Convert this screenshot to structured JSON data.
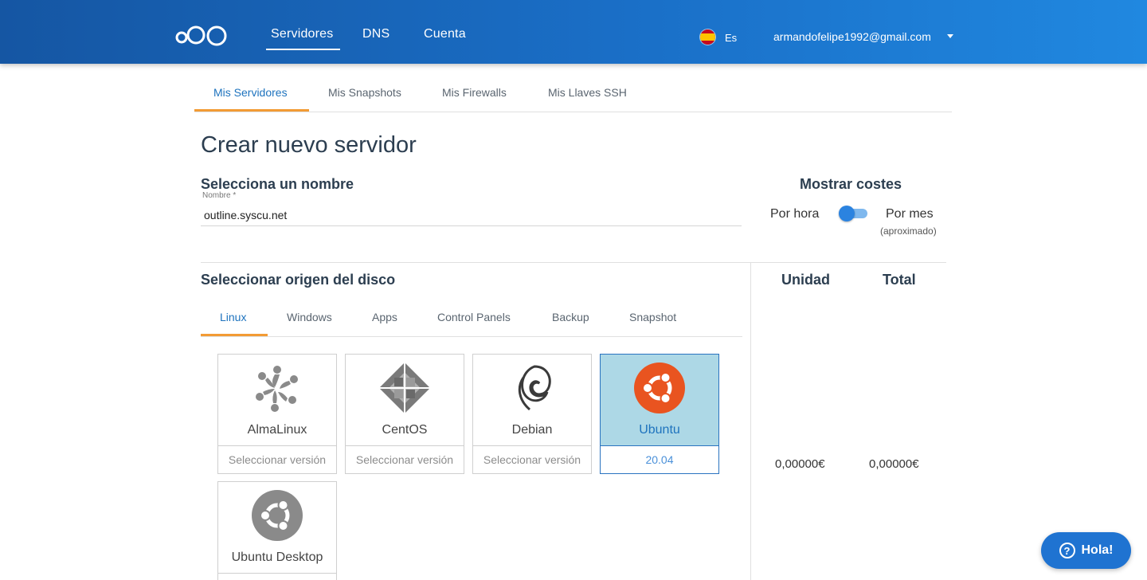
{
  "header": {
    "nav": [
      "Servidores",
      "DNS",
      "Cuenta"
    ],
    "lang": "Es",
    "user_email": "armandofelipe1992@gmail.com"
  },
  "subtabs": [
    "Mis Servidores",
    "Mis Snapshots",
    "Mis Firewalls",
    "Mis Llaves SSH"
  ],
  "page_title": "Crear nuevo servidor",
  "name_section": {
    "title": "Selecciona un nombre",
    "field_label": "Nombre *",
    "value": "outline.syscu.net"
  },
  "costs": {
    "title": "Mostrar costes",
    "hourly": "Por hora",
    "monthly": "Por mes",
    "monthly_sub": "(aproximado)",
    "toggle_on": false
  },
  "disk_section": {
    "title": "Seleccionar origen del disco",
    "tabs": [
      "Linux",
      "Windows",
      "Apps",
      "Control Panels",
      "Backup",
      "Snapshot"
    ],
    "os_cards": [
      {
        "name": "AlmaLinux",
        "version": "Seleccionar versión",
        "icon": "almalinux-icon"
      },
      {
        "name": "CentOS",
        "version": "Seleccionar versión",
        "icon": "centos-icon"
      },
      {
        "name": "Debian",
        "version": "Seleccionar versión",
        "icon": "debian-icon"
      },
      {
        "name": "Ubuntu",
        "version": "20.04",
        "icon": "ubuntu-icon",
        "selected": true
      },
      {
        "name": "Ubuntu Desktop",
        "version": "",
        "icon": "ubuntu-desktop-icon"
      }
    ]
  },
  "price_table": {
    "unit_header": "Unidad",
    "total_header": "Total",
    "unit_value": "0,00000€",
    "total_value": "0,00000€"
  },
  "help": {
    "label": "Hola!",
    "icon_glyph": "?"
  },
  "colors": {
    "brand_blue": "#1a6fc7",
    "accent_orange": "#f29b34",
    "ubuntu_orange": "#e95420",
    "selected_bg": "#add8e6"
  }
}
